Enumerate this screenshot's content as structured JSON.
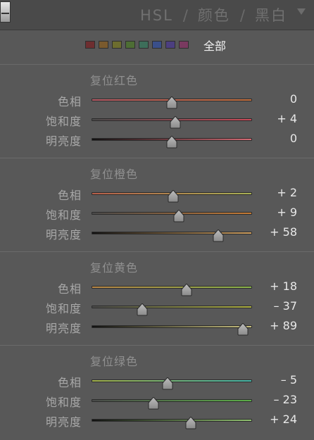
{
  "header": {
    "tabs": [
      "HSL",
      "颜色",
      "黑白"
    ],
    "separator": "/"
  },
  "swatchbar": {
    "colors": [
      "#6e2e30",
      "#7a5a2e",
      "#6d6d2e",
      "#4d6d34",
      "#3d6e5a",
      "#3a4f8a",
      "#4c3f80",
      "#7a3a60"
    ],
    "all_label": "全部"
  },
  "sections": [
    {
      "reset_label": "复位红色",
      "rows": [
        {
          "label": "色相",
          "value": "0",
          "level": 0,
          "track": [
            "#b65a66",
            "#c2703e"
          ]
        },
        {
          "label": "饱和度",
          "value": "+ 4",
          "level": 4,
          "track": [
            "#4a4a4a",
            "#c94a58"
          ]
        },
        {
          "label": "明亮度",
          "value": "0",
          "level": 0,
          "track": [
            "#111111",
            "#d46a74"
          ]
        }
      ]
    },
    {
      "reset_label": "复位橙色",
      "rows": [
        {
          "label": "色相",
          "value": "+ 2",
          "level": 2,
          "track": [
            "#b65e4a",
            "#a8b054"
          ]
        },
        {
          "label": "饱和度",
          "value": "+ 9",
          "level": 9,
          "track": [
            "#4a4a4a",
            "#c67a34"
          ]
        },
        {
          "label": "明亮度",
          "value": "+ 58",
          "level": 58,
          "track": [
            "#111111",
            "#d0a060"
          ]
        }
      ]
    },
    {
      "reset_label": "复位黄色",
      "rows": [
        {
          "label": "色相",
          "value": "+ 18",
          "level": 18,
          "track": [
            "#b88646",
            "#8ab44c"
          ]
        },
        {
          "label": "饱和度",
          "value": "– 37",
          "level": -37,
          "track": [
            "#4a4a4a",
            "#aeb040"
          ]
        },
        {
          "label": "明亮度",
          "value": "+ 89",
          "level": 89,
          "track": [
            "#111111",
            "#c8c080"
          ]
        }
      ]
    },
    {
      "reset_label": "复位绿色",
      "rows": [
        {
          "label": "色相",
          "value": "– 5",
          "level": -5,
          "track": [
            "#a2b04a",
            "#46b4a8"
          ]
        },
        {
          "label": "饱和度",
          "value": "– 23",
          "level": -23,
          "track": [
            "#4a4a4a",
            "#5cae48"
          ]
        },
        {
          "label": "明亮度",
          "value": "+ 24",
          "level": 24,
          "track": [
            "#111111",
            "#90c070"
          ]
        }
      ]
    }
  ]
}
